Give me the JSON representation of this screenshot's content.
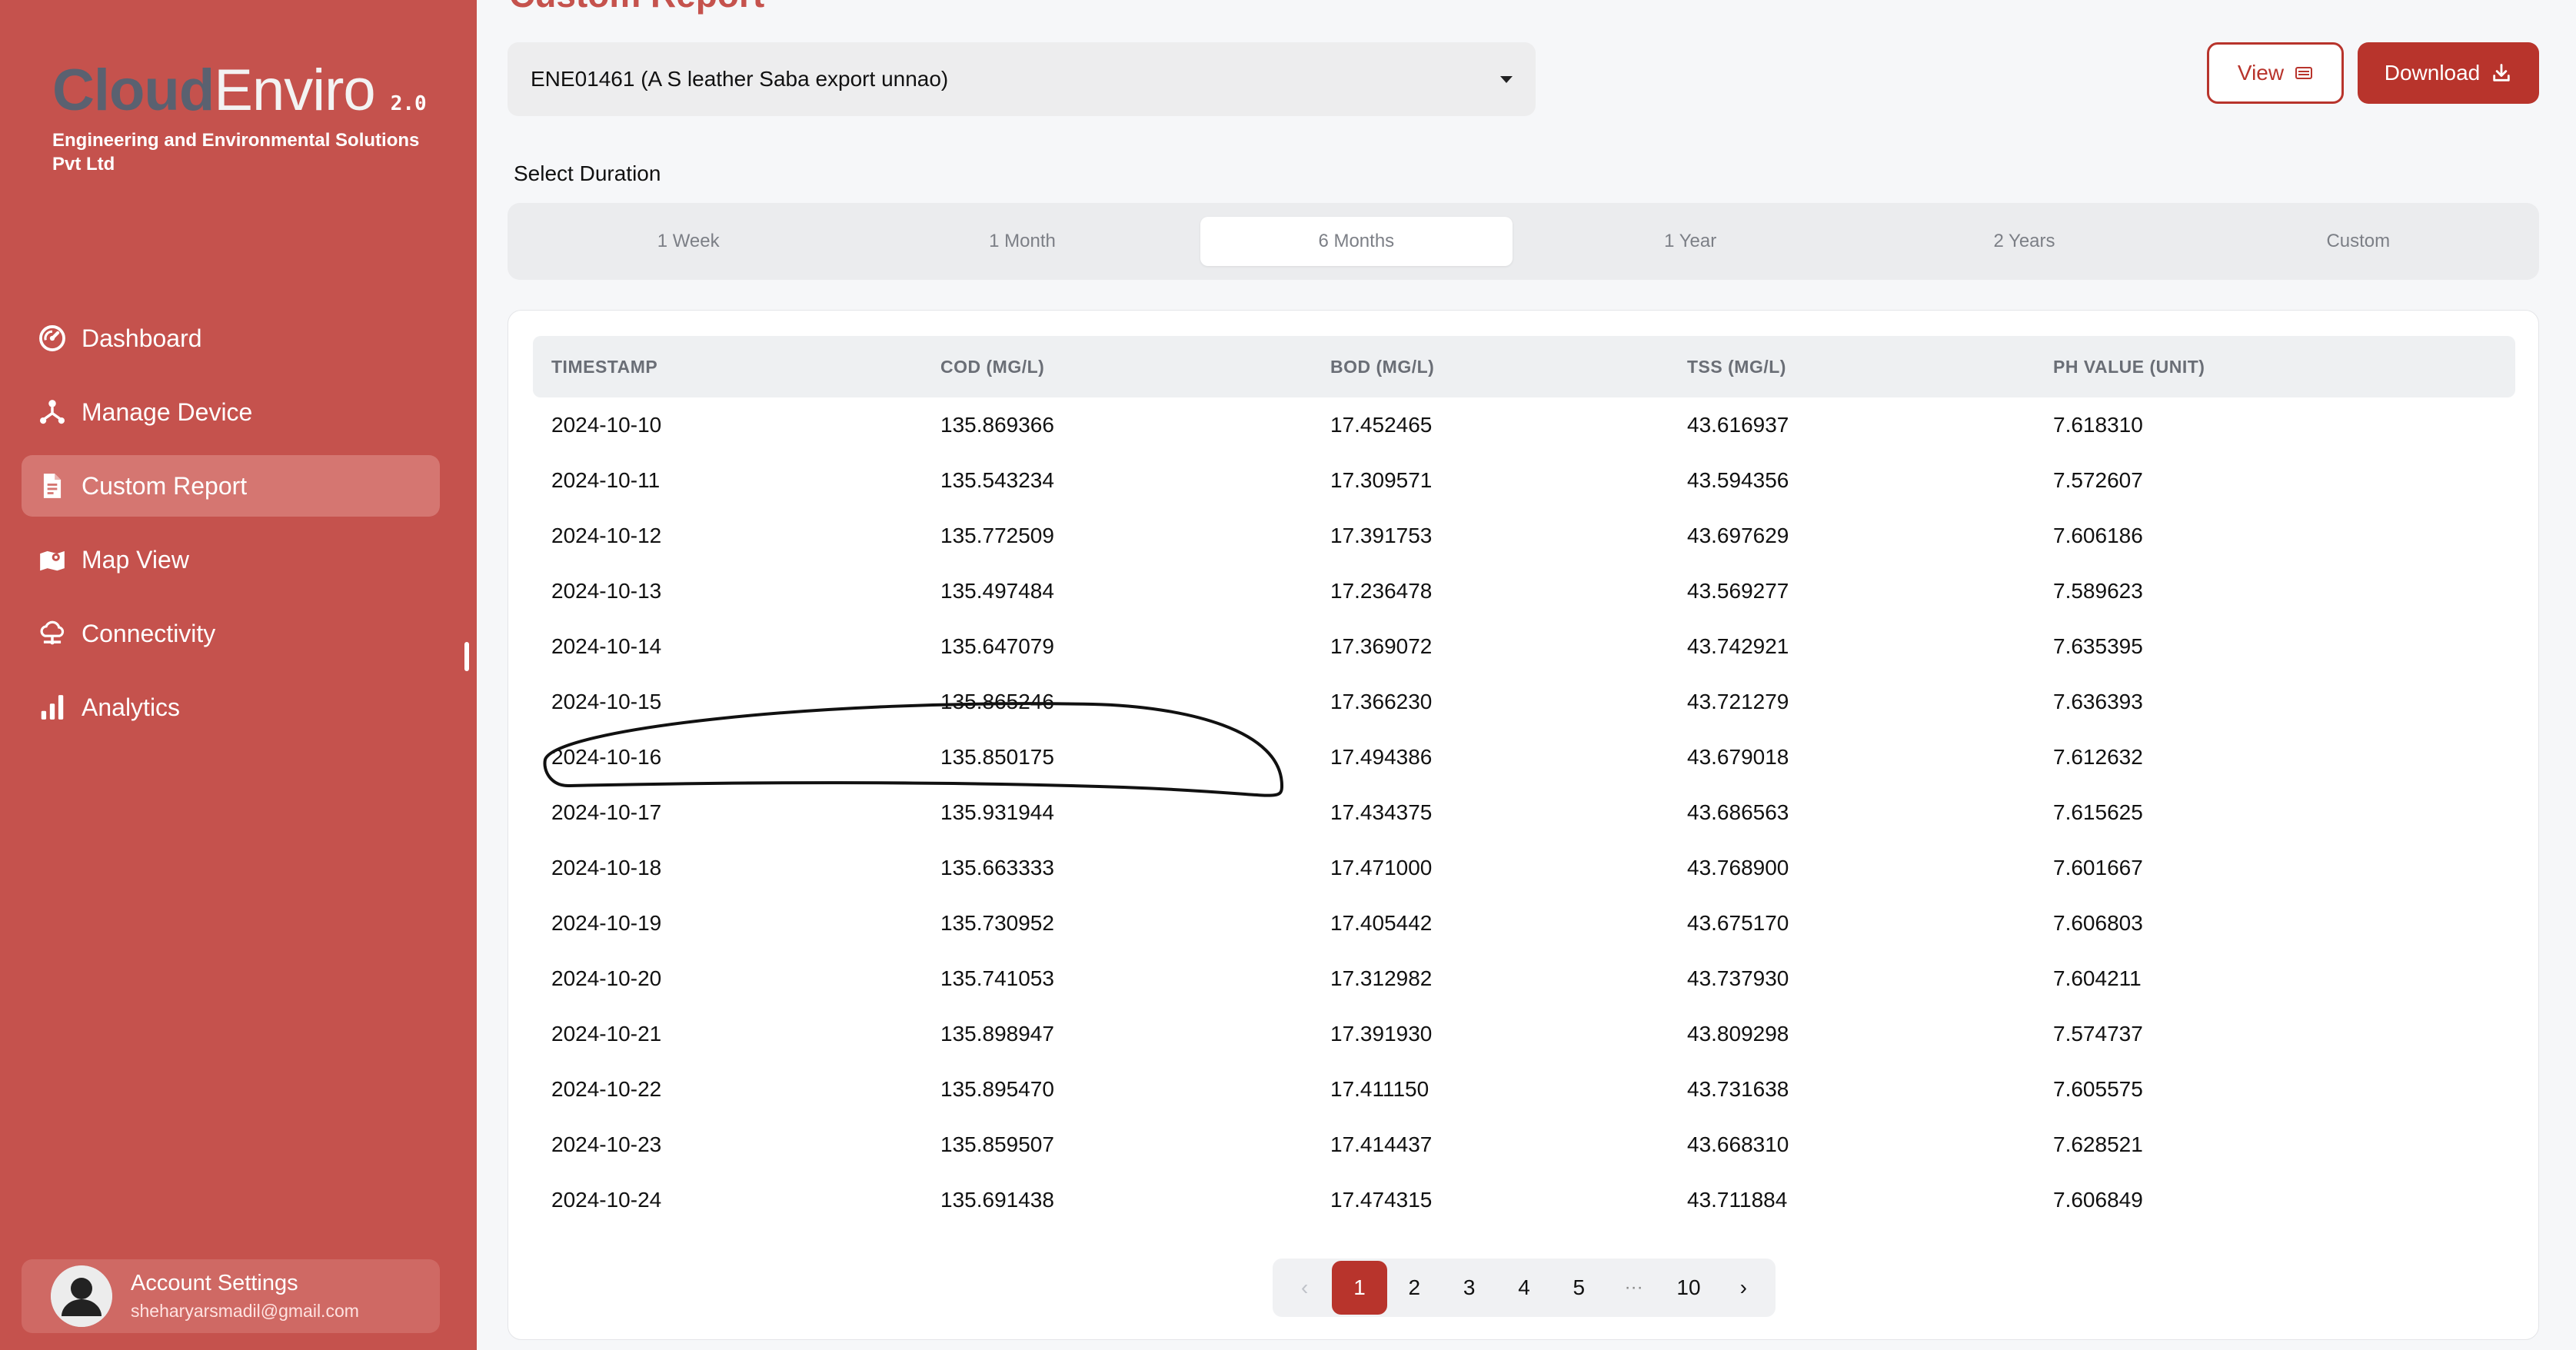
{
  "app": {
    "logo_cloud": "Cloud",
    "logo_enviro": "Enviro",
    "version": "2.0",
    "company": "Engineering and Environmental Solutions Pvt Ltd"
  },
  "sidebar": {
    "items": [
      {
        "label": "Dashboard",
        "icon": "dashboard-gauge-icon",
        "active": false
      },
      {
        "label": "Manage Device",
        "icon": "device-network-icon",
        "active": false
      },
      {
        "label": "Custom Report",
        "icon": "report-document-icon",
        "active": true
      },
      {
        "label": "Map View",
        "icon": "map-icon",
        "active": false
      },
      {
        "label": "Connectivity",
        "icon": "connectivity-cloud-icon",
        "active": false
      },
      {
        "label": "Analytics",
        "icon": "analytics-bar-icon",
        "active": false
      }
    ]
  },
  "account": {
    "title": "Account Settings",
    "email": "sheharyarsmadil@gmail.com"
  },
  "page": {
    "heading": "Custom Report"
  },
  "device": {
    "selected": "ENE01461 (A S leather Saba export unnao)"
  },
  "toolbar": {
    "view_label": "View",
    "download_label": "Download"
  },
  "duration": {
    "label": "Select Duration",
    "tabs": [
      "1 Week",
      "1 Month",
      "6 Months",
      "1 Year",
      "2 Years",
      "Custom"
    ],
    "active": "6 Months"
  },
  "table": {
    "headers": [
      "TIMESTAMP",
      "COD (MG/L)",
      "BOD (MG/L)",
      "TSS (MG/L)",
      "PH VALUE (UNIT)"
    ],
    "rows": [
      [
        "2024-10-10",
        "135.869366",
        "17.452465",
        "43.616937",
        "7.618310"
      ],
      [
        "2024-10-11",
        "135.543234",
        "17.309571",
        "43.594356",
        "7.572607"
      ],
      [
        "2024-10-12",
        "135.772509",
        "17.391753",
        "43.697629",
        "7.606186"
      ],
      [
        "2024-10-13",
        "135.497484",
        "17.236478",
        "43.569277",
        "7.589623"
      ],
      [
        "2024-10-14",
        "135.647079",
        "17.369072",
        "43.742921",
        "7.635395"
      ],
      [
        "2024-10-15",
        "135.865246",
        "17.366230",
        "43.721279",
        "7.636393"
      ],
      [
        "2024-10-16",
        "135.850175",
        "17.494386",
        "43.679018",
        "7.612632"
      ],
      [
        "2024-10-17",
        "135.931944",
        "17.434375",
        "43.686563",
        "7.615625"
      ],
      [
        "2024-10-18",
        "135.663333",
        "17.471000",
        "43.768900",
        "7.601667"
      ],
      [
        "2024-10-19",
        "135.730952",
        "17.405442",
        "43.675170",
        "7.606803"
      ],
      [
        "2024-10-20",
        "135.741053",
        "17.312982",
        "43.737930",
        "7.604211"
      ],
      [
        "2024-10-21",
        "135.898947",
        "17.391930",
        "43.809298",
        "7.574737"
      ],
      [
        "2024-10-22",
        "135.895470",
        "17.411150",
        "43.731638",
        "7.605575"
      ],
      [
        "2024-10-23",
        "135.859507",
        "17.414437",
        "43.668310",
        "7.628521"
      ],
      [
        "2024-10-24",
        "135.691438",
        "17.474315",
        "43.711884",
        "7.606849"
      ]
    ]
  },
  "pagination": {
    "prev": "‹",
    "pages": [
      "1",
      "2",
      "3",
      "4",
      "5"
    ],
    "ellipsis": "···",
    "last": "10",
    "next": "›",
    "current": "1"
  },
  "colors": {
    "sidebar": "#c5524d",
    "accent": "#b8342c",
    "active_nav": "#d57671"
  }
}
